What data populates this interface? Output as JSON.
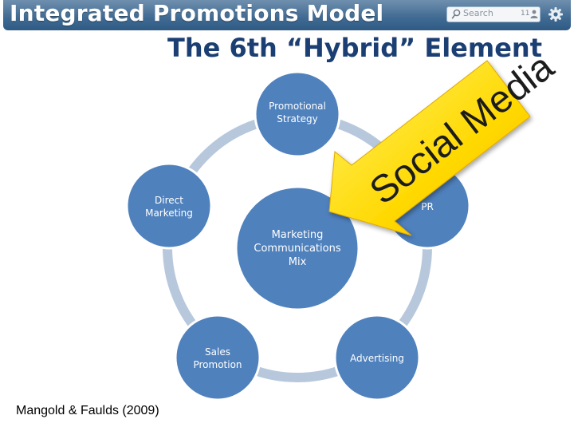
{
  "header": {
    "title": "Integrated Promotions Model",
    "search_placeholder": "Search",
    "count": "11"
  },
  "slide": {
    "subtitle": "The 6th “Hybrid” Element",
    "nodes": {
      "center": [
        "Marketing",
        "Communications",
        "Mix"
      ],
      "top": [
        "Promotional",
        "Strategy"
      ],
      "left": [
        "Direct",
        "Marketing"
      ],
      "right": [
        "PR"
      ],
      "bottom_left": [
        "Sales",
        "Promotion"
      ],
      "bottom_right": [
        "Advertising"
      ]
    },
    "arrow_text": "Social Media",
    "citation": "Mangold & Faulds (2009)"
  },
  "icons": [
    "search-icon",
    "user-icon",
    "gear-icon"
  ],
  "colors": {
    "header_bg": "#3f6a92",
    "subtitle": "#1b3f73",
    "node_fill": "#4f81bd",
    "ring": "#b8c8dc",
    "arrow_fill": "#ffd500"
  }
}
